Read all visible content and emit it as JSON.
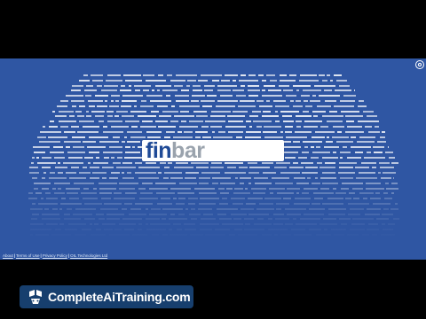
{
  "logo": {
    "part1": "fin",
    "part2": "bar"
  },
  "footer": {
    "links": [
      "About",
      "Terms of Use",
      "Privacy Policy",
      "OIL Technologies Ltd"
    ],
    "separator": "|"
  },
  "brand": {
    "text": "CompleteAiTraining.com"
  },
  "icons": {
    "settings": "settings-icon",
    "brand": "robot-logo-icon"
  },
  "colors": {
    "background": "#000000",
    "stage": "#2f56a3",
    "logo_fin": "#1f4a96",
    "logo_bar": "#9aa3ad",
    "brand_banner": "#173f6e"
  }
}
